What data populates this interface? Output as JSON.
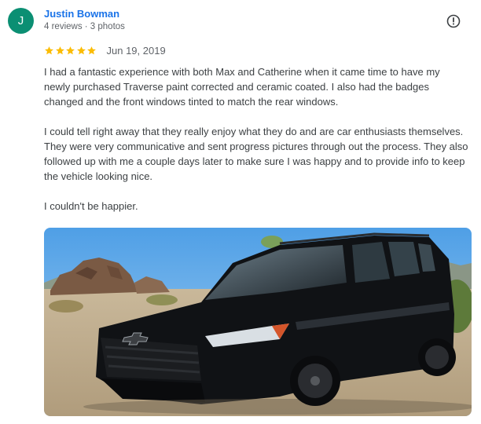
{
  "reviewer": {
    "initial": "J",
    "name": "Justin Bowman",
    "stats": "4 reviews · 3 photos",
    "avatar_color": "#0b8f73"
  },
  "rating": {
    "stars": 5,
    "max": 5,
    "star_color": "#fbbc04"
  },
  "date": "Jun 19, 2019",
  "review_paragraphs": [
    "I had a fantastic experience with both Max and Catherine when it came time to have my newly purchased Traverse paint corrected and ceramic coated. I also had the badges changed and the front windows tinted to match the rear windows.",
    "I could tell right away that they really enjoy what they do and are car enthusiasts themselves. They were very communicative and sent progress pictures through out the process. They also followed up with me a couple days later to make sure I was happy and to provide info to keep the vehicle looking nice.",
    "I couldn't be happier."
  ],
  "icons": {
    "report": "report-icon",
    "star": "star-icon"
  },
  "photo": {
    "subject": "black SUV parked in desert"
  }
}
